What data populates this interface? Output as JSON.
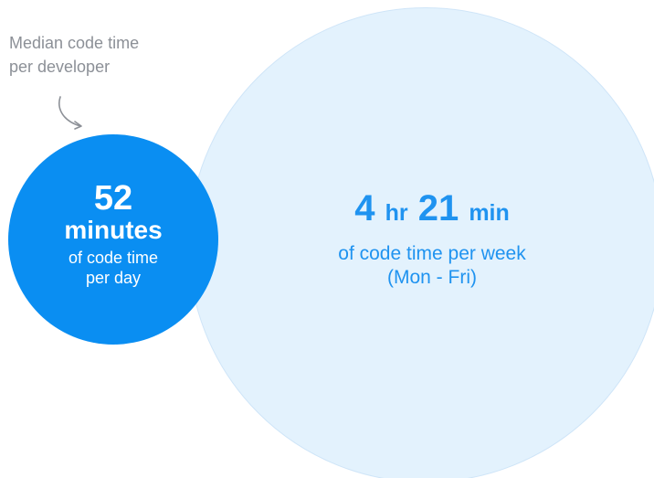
{
  "caption": {
    "line1": "Median code time",
    "line2": "per developer"
  },
  "daily": {
    "value": "52",
    "unit": "minutes",
    "line1": "of code time",
    "line2": "per day"
  },
  "weekly": {
    "hours_value": "4",
    "hours_unit": "hr",
    "minutes_value": "21",
    "minutes_unit": "min",
    "line1": "of code time per week",
    "line2": "(Mon - Fri)"
  },
  "colors": {
    "daily_circle": "#0a8ef2",
    "weekly_circle": "#e3f2fd",
    "weekly_text": "#1f93f0",
    "caption_text": "#8c9097"
  },
  "icons": {
    "pointer": "curved-arrow-icon"
  }
}
